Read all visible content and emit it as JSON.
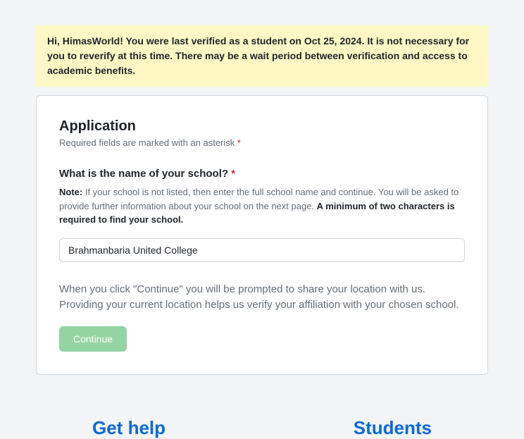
{
  "banner": {
    "text": "Hi, HimasWorld! You were last verified as a student on Oct 25, 2024. It is not necessary for you to reverify at this time. There may be a wait period between verification and access to academic benefits."
  },
  "card": {
    "title": "Application",
    "required_note": "Required fields are marked with an asterisk",
    "asterisk": "*",
    "field": {
      "label": "What is the name of your school?",
      "note_bold": "Note:",
      "note_text": " If your school is not listed, then enter the full school name and continue. You will be asked to provide further information about your school on the next page. ",
      "note_tail": "A minimum of two characters is required to find your school.",
      "value": "Brahmanbaria United College"
    },
    "location_note": "When you click \"Continue\" you will be prompted to share your location with us. Providing your current location helps us verify your affiliation with your chosen school.",
    "continue_label": "Continue"
  },
  "footer": {
    "left": "Get help",
    "right": "Students"
  }
}
